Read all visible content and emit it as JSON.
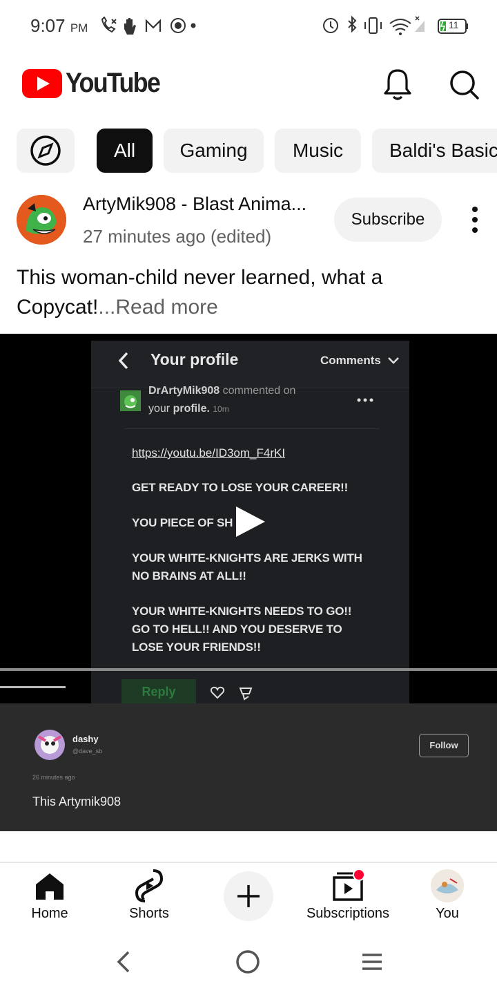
{
  "status_bar": {
    "time": "9:07",
    "ampm": "PM",
    "battery": "11"
  },
  "header": {
    "logo_text": "YouTube",
    "brand_color": "#ff0000",
    "icons": [
      "bell-icon",
      "search-icon"
    ]
  },
  "chips": {
    "explore_icon": "compass-icon",
    "items": [
      "All",
      "Gaming",
      "Music",
      "Baldi's Basics"
    ],
    "selected": "All"
  },
  "post": {
    "channel": "ArtyMik908 - Blast Anima...",
    "meta": "27 minutes ago (edited)",
    "subscribe_label": "Subscribe",
    "text": "This woman-child never learned, what a Copycat!",
    "read_more": "...Read more"
  },
  "video": {
    "title": "Your profile",
    "comments_label": "Comments",
    "commenter": "DrArtyMik908",
    "commented_on": "commented on",
    "your": "your",
    "profile": "profile.",
    "age": "10m",
    "link": "https://youtu.be/ID3om_F4rKI",
    "line1": "GET READY TO LOSE YOUR CAREER!!",
    "line2": "YOU PIECE OF SH",
    "line3a": "YOUR WHITE-KNIGHTS ARE JERKS WITH",
    "line3b": "NO BRAINS AT ALL!!",
    "line4a": "YOUR WHITE-KNIGHTS NEEDS TO GO!!",
    "line4b": "GO TO HELL!! AND YOU DESERVE TO",
    "line4c": "LOSE YOUR FRIENDS!!",
    "reply_label": "Reply"
  },
  "comment_card": {
    "user": "dashy",
    "handle": "@dave_sb",
    "follow_label": "Follow",
    "time": "26 minutes ago",
    "text": "This Artymik908"
  },
  "bottom_nav": {
    "home": "Home",
    "shorts": "Shorts",
    "subscriptions": "Subscriptions",
    "you": "You"
  }
}
